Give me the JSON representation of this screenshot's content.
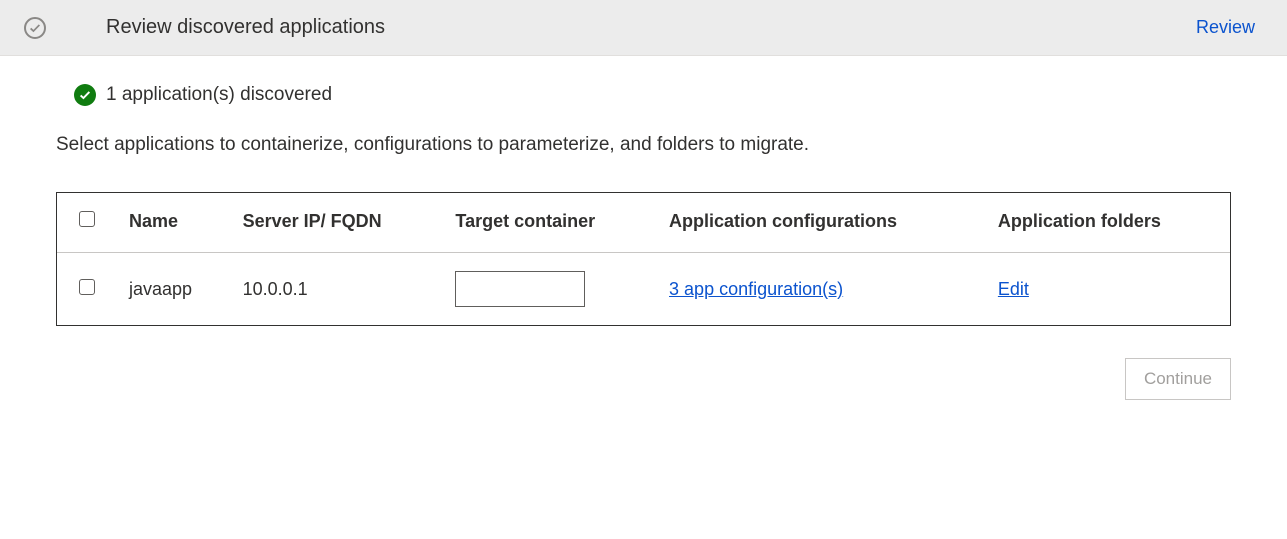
{
  "header": {
    "title": "Review discovered applications",
    "review_link": "Review"
  },
  "status": {
    "text": "1 application(s) discovered"
  },
  "description": "Select applications to containerize, configurations to parameterize, and folders to migrate.",
  "table": {
    "columns": {
      "name": "Name",
      "server": "Server IP/ FQDN",
      "target": "Target container",
      "configs": "Application configurations",
      "folders": "Application folders"
    },
    "rows": [
      {
        "name": "javaapp",
        "server": "10.0.0.1",
        "target": "",
        "configs_link": "3 app configuration(s)",
        "folders_link": "Edit"
      }
    ]
  },
  "footer": {
    "continue": "Continue"
  }
}
